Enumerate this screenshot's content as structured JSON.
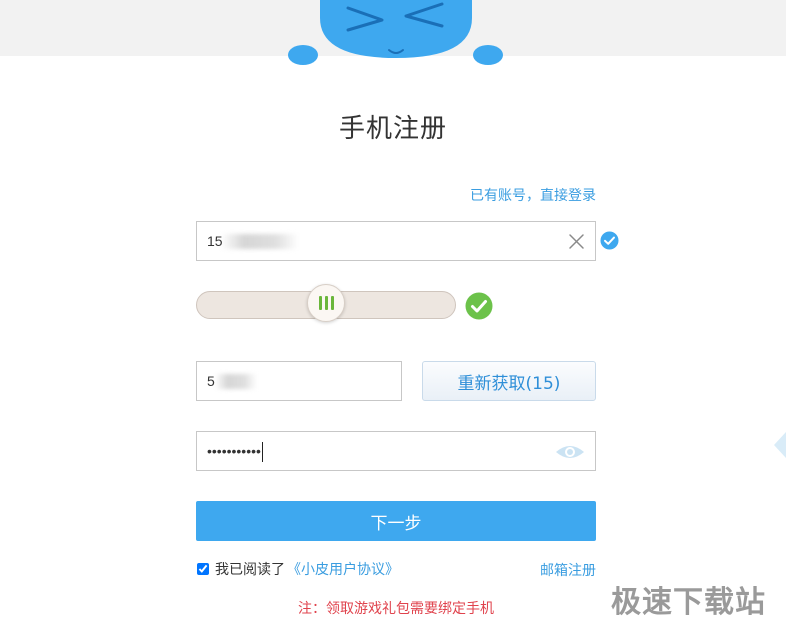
{
  "header": {
    "title": "手机注册",
    "login_link": "已有账号，直接登录"
  },
  "form": {
    "phone_value": "15",
    "verification_code_value": "5",
    "resend_label": "重新获取(15)",
    "password_value": "***********",
    "next_label": "下一步",
    "agreement_prefix": "我已阅读了",
    "agreement_link": "《小皮用户协议》",
    "agreement_checked": true,
    "email_register_label": "邮箱注册",
    "note": "注：领取游戏礼包需要绑定手机"
  },
  "slider": {
    "progress": 0.5,
    "verified": true
  },
  "watermark": "极速下载站",
  "icons": {
    "clear": "clear-icon",
    "check_small": "check-circle-icon",
    "check_big": "check-circle-icon",
    "eye": "eye-icon",
    "mascot": "mascot-illustration"
  },
  "colors": {
    "accent": "#3ea8ef",
    "link": "#3a9de0",
    "success": "#6cc24a",
    "note_red": "#e0434d"
  }
}
